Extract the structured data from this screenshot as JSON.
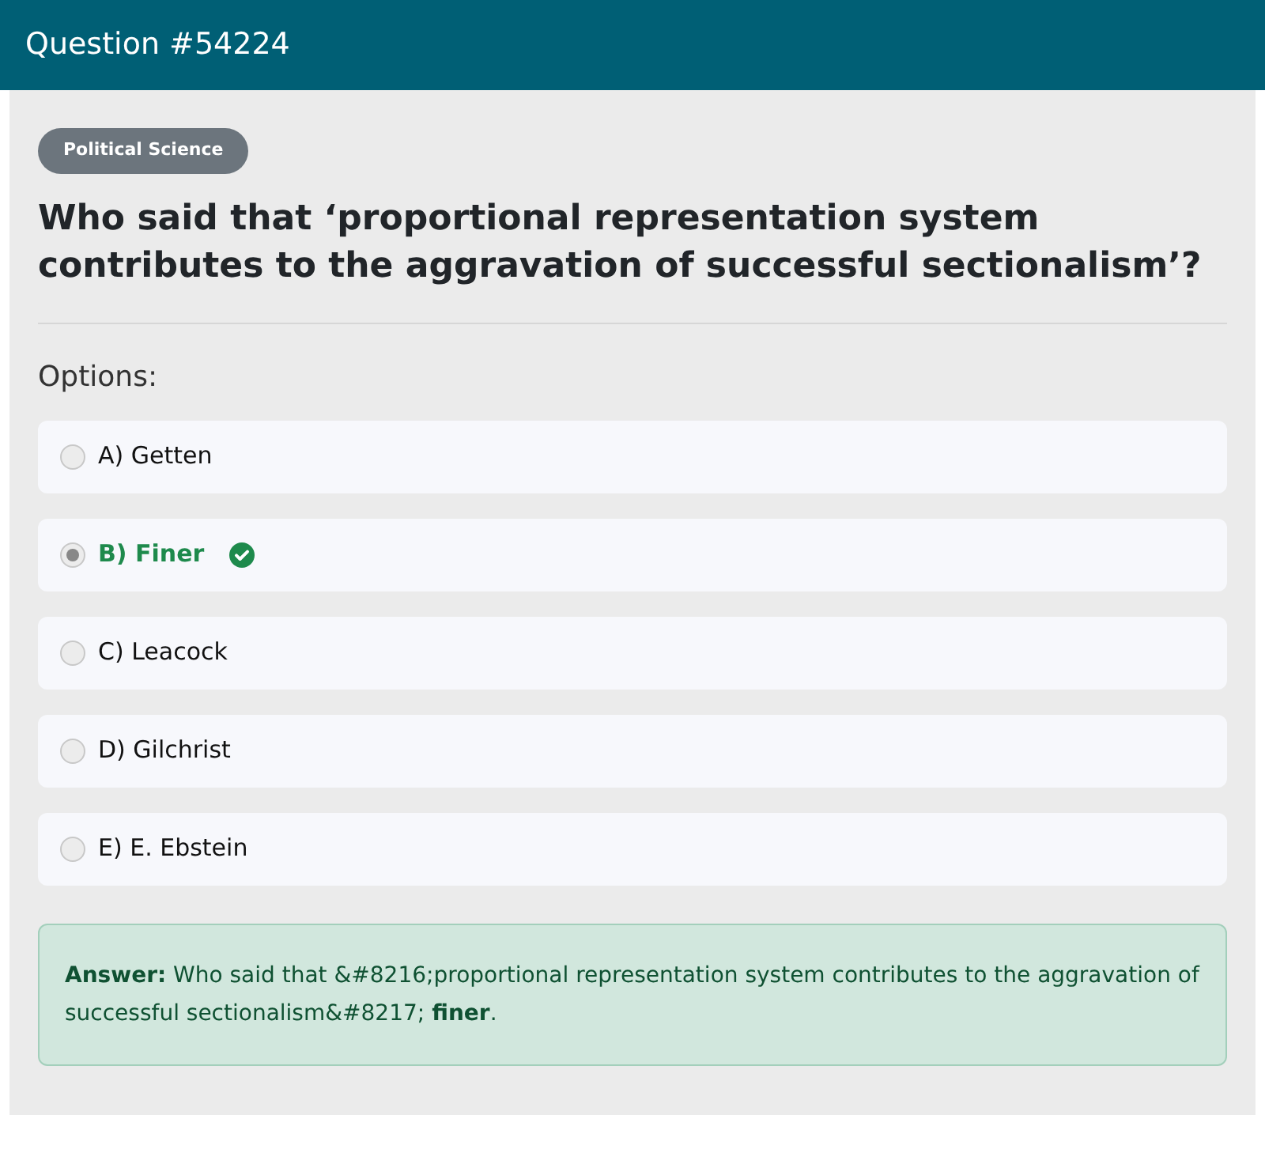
{
  "header": {
    "title": "Question #54224"
  },
  "category": "Political Science",
  "question": "Who said that ‘proportional representation system contributes to the aggravation of successful sectionalism’?",
  "options_label": "Options:",
  "options": [
    {
      "label": "A) Getten",
      "selected": false,
      "correct": false
    },
    {
      "label": "B) Finer",
      "selected": true,
      "correct": true
    },
    {
      "label": "C) Leacock",
      "selected": false,
      "correct": false
    },
    {
      "label": "D) Gilchrist",
      "selected": false,
      "correct": false
    },
    {
      "label": "E) E. Ebstein",
      "selected": false,
      "correct": false
    }
  ],
  "answer": "**Answer:** Who said that &#8216;proportional representation system contributes to the aggravation of successful sectionalism&#8217; **finer**."
}
